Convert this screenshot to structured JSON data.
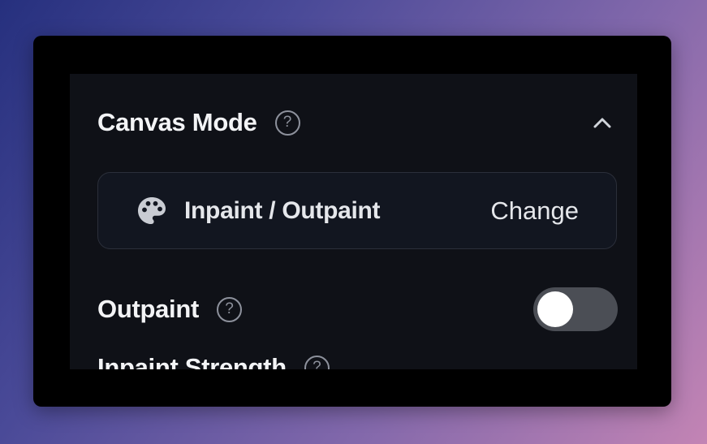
{
  "canvas_mode": {
    "title": "Canvas Mode",
    "help_icon": "?",
    "collapse_icon": "chevron-up-icon",
    "selected_mode": {
      "icon": "palette-icon",
      "label": "Inpaint / Outpaint",
      "change_label": "Change"
    },
    "outpaint": {
      "label": "Outpaint",
      "help_icon": "?",
      "enabled": false
    },
    "inpaint_strength": {
      "label": "Inpaint Strength",
      "help_icon": "?"
    }
  },
  "colors": {
    "panel_bg": "#0f1117",
    "card_border": "#2b2f3a",
    "toggle_off_bg": "#4b4e55"
  }
}
